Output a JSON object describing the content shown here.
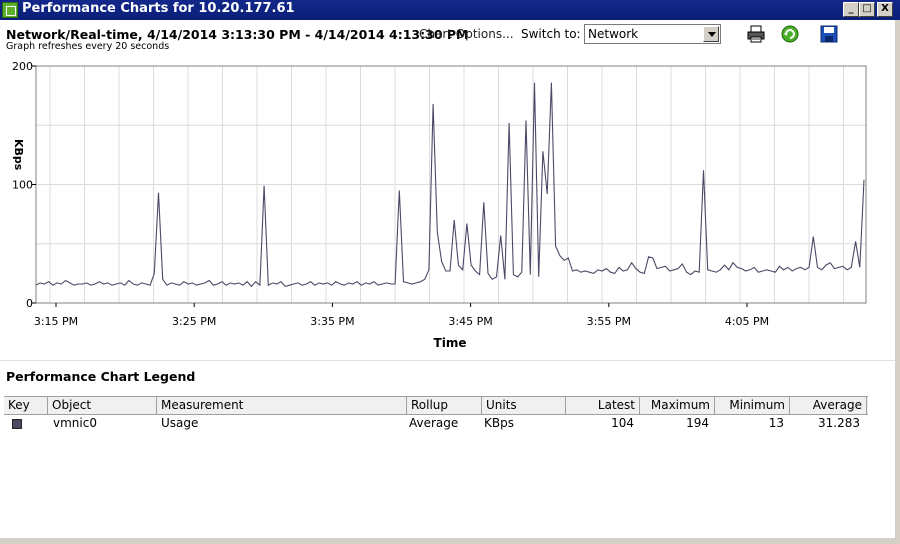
{
  "window": {
    "title": "Performance Charts for 10.20.177.61",
    "minimize_label": "_",
    "maximize_label": "□",
    "close_label": "X"
  },
  "toolbar": {
    "heading": "Network/Real-time, 4/14/2014 3:13:30 PM - 4/14/2014 4:13:30 PM",
    "refresh_note": "Graph refreshes every 20 seconds",
    "chart_options_label": "Chart Options...",
    "switch_to_label": "Switch to:",
    "switch_to_value": "Network",
    "icons": [
      "printer-icon",
      "refresh-icon",
      "save-icon"
    ]
  },
  "chart_data": {
    "type": "line",
    "ylabel": "KBps",
    "xlabel": "Time",
    "ylim": [
      0,
      200
    ],
    "yticks": [
      "200",
      "100",
      "0"
    ],
    "xticks": [
      "3:15 PM",
      "3:25 PM",
      "3:35 PM",
      "3:45 PM",
      "3:55 PM",
      "4:05 PM"
    ],
    "grid": true,
    "series": [
      {
        "name": "vmnic0",
        "color": "#4a4a66",
        "values": [
          15,
          17,
          16,
          18,
          15,
          17,
          16,
          19,
          17,
          15,
          16,
          16,
          17,
          15,
          16,
          18,
          16,
          17,
          15,
          16,
          17,
          15,
          19,
          16,
          15,
          17,
          16,
          15,
          25,
          93,
          20,
          15,
          17,
          16,
          15,
          18,
          16,
          17,
          15,
          16,
          17,
          19,
          15,
          16,
          18,
          15,
          17,
          16,
          17,
          15,
          18,
          14,
          18,
          15,
          99,
          15,
          17,
          16,
          18,
          14,
          15,
          16,
          17,
          15,
          16,
          18,
          15,
          17,
          16,
          17,
          15,
          18,
          16,
          15,
          17,
          16,
          18,
          15,
          17,
          16,
          18,
          15,
          16,
          17,
          16,
          16,
          95,
          18,
          17,
          16,
          17,
          18,
          20,
          28,
          168,
          60,
          35,
          27,
          27,
          70,
          32,
          28,
          67,
          32,
          27,
          24,
          85,
          25,
          20,
          22,
          57,
          20,
          152,
          24,
          22,
          26,
          154,
          24,
          186,
          22,
          128,
          92,
          186,
          48,
          40,
          36,
          38,
          27,
          28,
          26,
          27,
          26,
          25,
          28,
          27,
          29,
          26,
          25,
          30,
          27,
          28,
          34,
          29,
          26,
          25,
          39,
          38,
          29,
          30,
          31,
          27,
          28,
          29,
          33,
          26,
          24,
          27,
          26,
          112,
          28,
          27,
          26,
          28,
          32,
          28,
          34,
          30,
          29,
          27,
          28,
          30,
          26,
          27,
          28,
          27,
          26,
          31,
          28,
          30,
          27,
          29,
          30,
          28,
          30,
          56,
          30,
          28,
          32,
          34,
          29,
          30,
          31,
          28,
          30,
          52,
          30,
          104
        ]
      }
    ]
  },
  "legend": {
    "title": "Performance Chart Legend",
    "columns": [
      "Key",
      "Object",
      "Measurement",
      "Rollup",
      "Units",
      "Latest",
      "Maximum",
      "Minimum",
      "Average"
    ],
    "rows": [
      {
        "object": "vmnic0",
        "measurement": "Usage",
        "rollup": "Average",
        "units": "KBps",
        "latest": "104",
        "maximum": "194",
        "minimum": "13",
        "average": "31.283",
        "swatch_color": "#4a4a66"
      }
    ]
  }
}
